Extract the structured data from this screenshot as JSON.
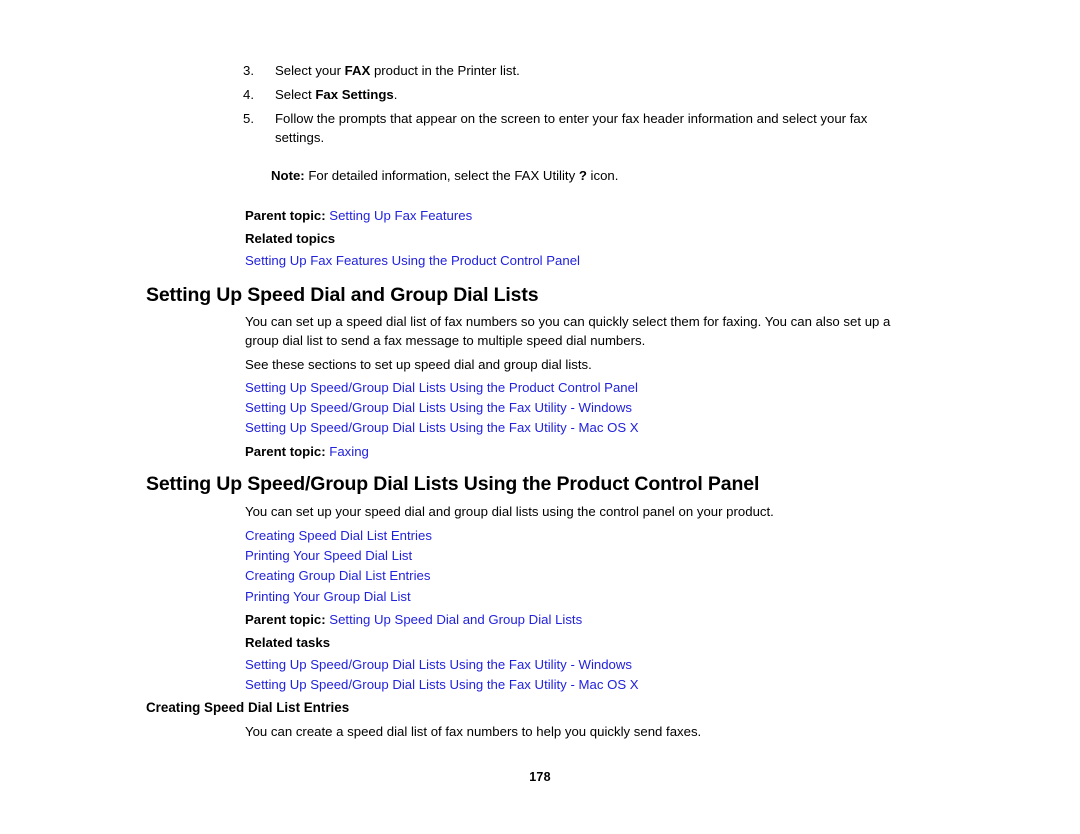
{
  "page": {
    "number": "178",
    "link_color": "#2222dd",
    "text_color": "#000000",
    "background_color": "#ffffff"
  },
  "steps": [
    {
      "num": "3.",
      "pre": "Select your ",
      "strong": "FAX",
      "post": " product in the Printer list."
    },
    {
      "num": "4.",
      "pre": "Select ",
      "strong": "Fax Settings",
      "post": "."
    },
    {
      "num": "5.",
      "pre": "Follow the prompts that appear on the screen to enter your fax header information and select your fax settings.",
      "strong": "",
      "post": ""
    }
  ],
  "note": {
    "label": "Note:",
    "text_before": " For detailed information, select the FAX Utility ",
    "icon": "?",
    "text_after": " icon."
  },
  "section_one": {
    "parent_topic_label": "Parent topic:",
    "parent_topic_link": "Setting Up Fax Features",
    "related_label": "Related topics",
    "related_links": [
      "Setting Up Fax Features Using the Product Control Panel"
    ]
  },
  "heading_speed_dial": "Setting Up Speed Dial and Group Dial Lists",
  "speed_dial_intro": "You can set up a speed dial list of fax numbers so you can quickly select them for faxing. You can also set up a group dial list to send a fax message to multiple speed dial numbers.",
  "speed_dial_see": "See these sections to set up speed dial and group dial lists.",
  "speed_dial_links": [
    "Setting Up Speed/Group Dial Lists Using the Product Control Panel",
    "Setting Up Speed/Group Dial Lists Using the Fax Utility - Windows",
    "Setting Up Speed/Group Dial Lists Using the Fax Utility - Mac OS X"
  ],
  "speed_dial_parent": {
    "label": "Parent topic:",
    "link": "Faxing"
  },
  "heading_control_panel": "Setting Up Speed/Group Dial Lists Using the Product Control Panel",
  "control_panel_intro": "You can set up your speed dial and group dial lists using the control panel on your product.",
  "control_panel_links": [
    "Creating Speed Dial List Entries",
    "Printing Your Speed Dial List",
    "Creating Group Dial List Entries",
    "Printing Your Group Dial List"
  ],
  "control_panel_parent": {
    "label": "Parent topic:",
    "link": "Setting Up Speed Dial and Group Dial Lists"
  },
  "related_tasks": {
    "label": "Related tasks",
    "links": [
      "Setting Up Speed/Group Dial Lists Using the Fax Utility - Windows",
      "Setting Up Speed/Group Dial Lists Using the Fax Utility - Mac OS X"
    ]
  },
  "heading_creating_speed_dial": "Creating Speed Dial List Entries",
  "creating_speed_dial_intro": "You can create a speed dial list of fax numbers to help you quickly send faxes."
}
